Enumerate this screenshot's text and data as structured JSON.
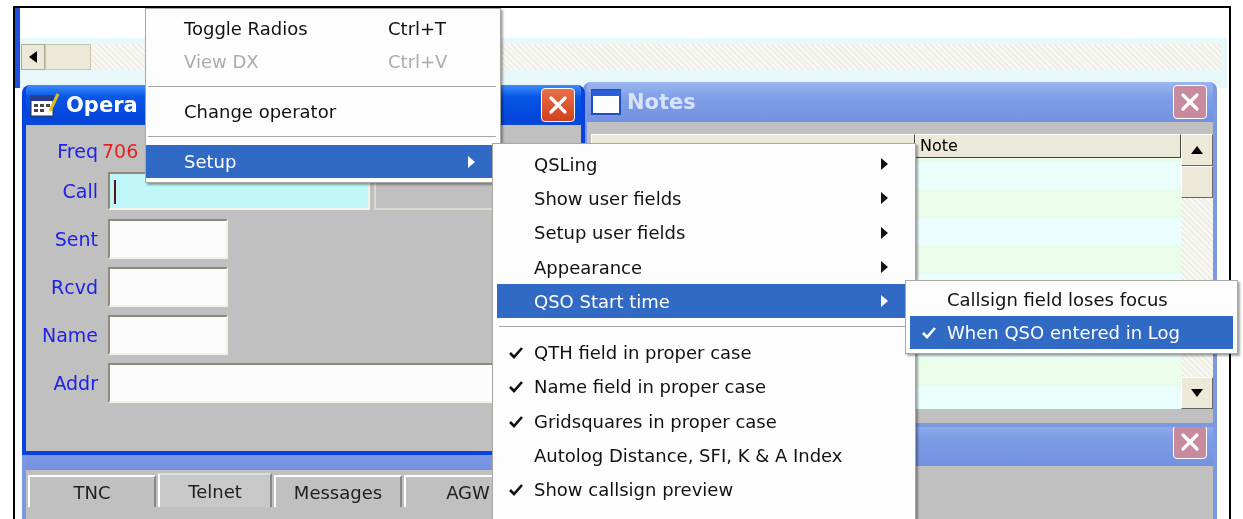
{
  "operator_window": {
    "title": "Opera",
    "active": true,
    "freq": {
      "label": "Freq",
      "value": "706"
    },
    "fields": [
      {
        "label": "Call",
        "kind": "short",
        "focused": true
      },
      {
        "label": "Sent",
        "kind": "tiny",
        "focused": false
      },
      {
        "label": "Rcvd",
        "kind": "tiny",
        "focused": false
      },
      {
        "label": "Name",
        "kind": "tiny",
        "focused": false
      },
      {
        "label": "Addr",
        "kind": "long",
        "focused": false
      }
    ]
  },
  "terminal_window": {
    "active": false,
    "tabs": [
      {
        "label": "TNC",
        "selected": false
      },
      {
        "label": "Telnet",
        "selected": true
      },
      {
        "label": "Messages",
        "selected": false
      },
      {
        "label": "AGW",
        "selected": false
      }
    ]
  },
  "notes_window": {
    "title": "Notes",
    "active": false,
    "columns": [
      "Note"
    ]
  },
  "lower_window": {
    "active": false
  },
  "menu": {
    "items": [
      {
        "kind": "item",
        "label": "Toggle Radios",
        "shortcut": "Ctrl+T",
        "disabled": false,
        "selected": false
      },
      {
        "kind": "item",
        "label": "View DX",
        "shortcut": "Ctrl+V",
        "disabled": true,
        "selected": false
      },
      {
        "kind": "separator"
      },
      {
        "kind": "item",
        "label": "Change operator",
        "disabled": false,
        "selected": false
      },
      {
        "kind": "separator"
      },
      {
        "kind": "submenu",
        "label": "Setup",
        "disabled": false,
        "selected": true
      }
    ]
  },
  "setup_menu": {
    "items": [
      {
        "kind": "submenu",
        "label": "QSLing",
        "selected": false
      },
      {
        "kind": "submenu",
        "label": "Show user fields",
        "selected": false
      },
      {
        "kind": "submenu",
        "label": "Setup user fields",
        "selected": false
      },
      {
        "kind": "submenu",
        "label": "Appearance",
        "selected": false
      },
      {
        "kind": "submenu",
        "label": "QSO Start time",
        "selected": true
      },
      {
        "kind": "separator"
      },
      {
        "kind": "item",
        "label": "QTH field in proper case",
        "checked": true,
        "selected": false
      },
      {
        "kind": "item",
        "label": "Name field in proper case",
        "checked": true,
        "selected": false
      },
      {
        "kind": "item",
        "label": "Gridsquares in proper case",
        "checked": true,
        "selected": false
      },
      {
        "kind": "item",
        "label": "Autolog Distance, SFI, K & A Index",
        "checked": false,
        "selected": false
      },
      {
        "kind": "item",
        "label": "Show callsign preview",
        "checked": true,
        "selected": false
      }
    ]
  },
  "qso_start_menu": {
    "items": [
      {
        "kind": "item",
        "label": "Callsign field loses focus",
        "checked": false,
        "selected": false
      },
      {
        "kind": "item",
        "label": "When QSO entered in Log",
        "checked": true,
        "selected": true
      }
    ]
  }
}
